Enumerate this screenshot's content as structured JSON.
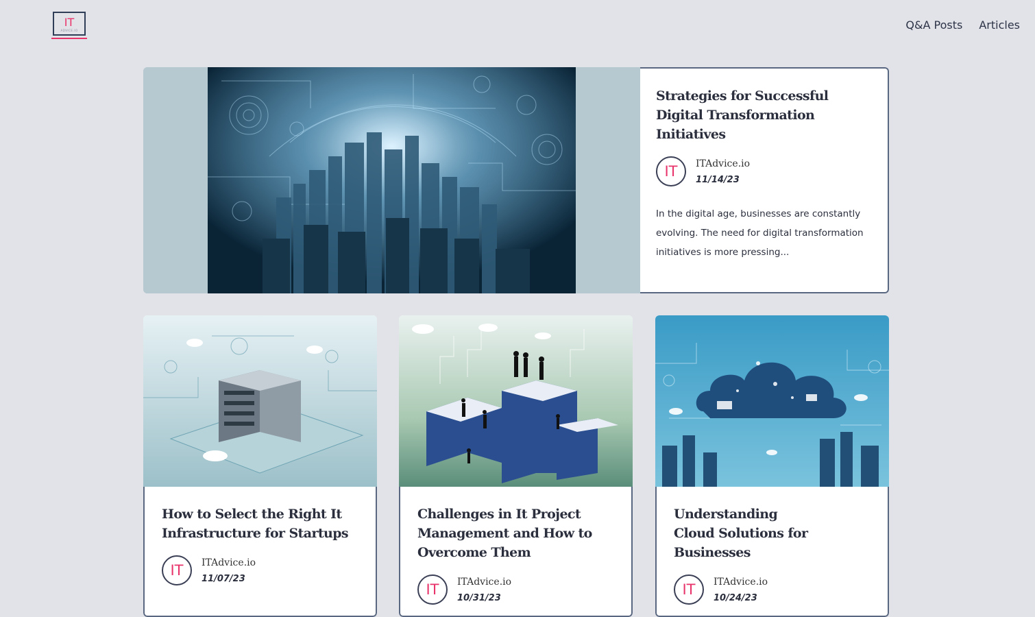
{
  "header": {
    "logo_text": "IT",
    "logo_subtext": "ADVICE.IO",
    "nav": [
      {
        "label": "Q&A Posts"
      },
      {
        "label": "Articles"
      }
    ]
  },
  "featured": {
    "title": "Strategies for Successful Digital Transformation Initiatives",
    "author": "ITAdvice.io",
    "date": "11/14/23",
    "excerpt": "In the digital age, businesses are constantly evolving. The need for digital transformation initiatives is more pressing...",
    "avatar_text": "IT"
  },
  "posts": [
    {
      "title": "How to Select the Right It Infrastructure for Startups",
      "author": "ITAdvice.io",
      "date": "11/07/23",
      "avatar_text": "IT"
    },
    {
      "title": "Challenges in It Project Management and How to Overcome Them",
      "author": "ITAdvice.io",
      "date": "10/31/23",
      "avatar_text": "IT"
    },
    {
      "title": "Understanding Cloud Solutions for Businesses",
      "author": "ITAdvice.io",
      "date": "10/24/23",
      "avatar_text": "IT"
    }
  ],
  "colors": {
    "accent": "#e8336b",
    "background": "#e2e3e8",
    "card_border": "#5a6780",
    "text": "#2b2f3d"
  }
}
